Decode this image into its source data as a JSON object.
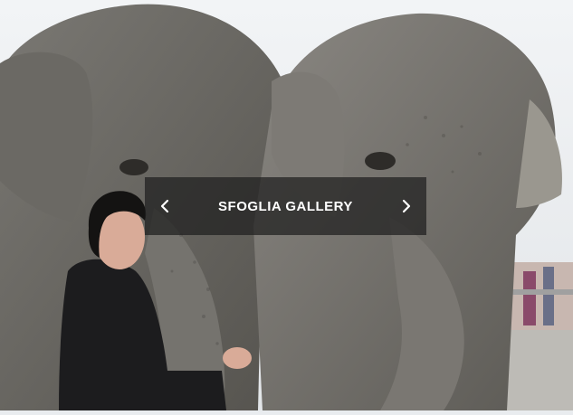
{
  "gallery": {
    "label": "SFOGLIA GALLERY",
    "prev_icon": "chevron-left-icon",
    "next_icon": "chevron-right-icon"
  },
  "photo": {
    "colors": {
      "sky": "#eef0f2",
      "elephant_skin": "#6e6c67",
      "elephant_dark": "#4a4844",
      "coat": "#1b1b1d",
      "ground": "#bcbab5",
      "overlay": "#1e1e1e"
    }
  }
}
